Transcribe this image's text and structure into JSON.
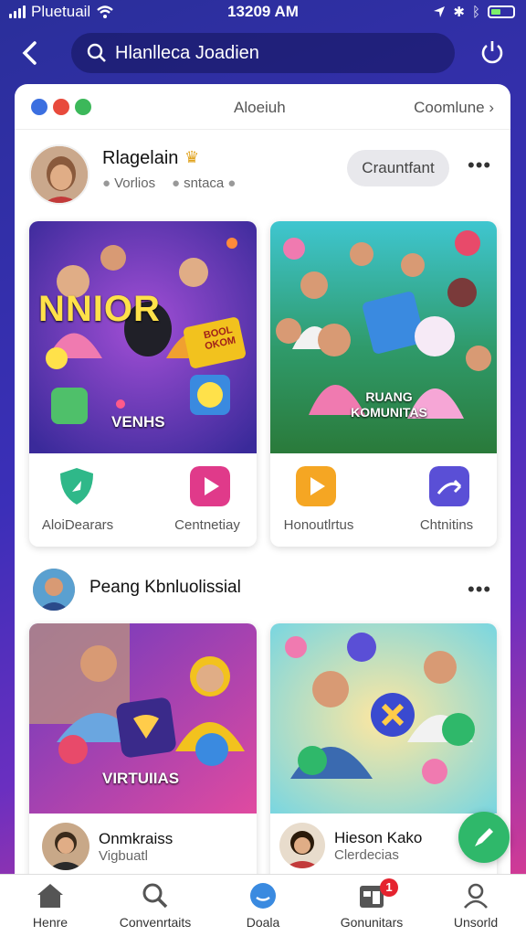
{
  "status_bar": {
    "carrier": "Pluetuail",
    "time": "13209 AM"
  },
  "search": {
    "value": "Hlanlleca Joadien"
  },
  "card_header": {
    "center_label": "Aloeiuh",
    "right_label": "Coomlune ›"
  },
  "post1": {
    "user_name": "Rlagelain",
    "meta": [
      "Vorlios",
      "sntaca"
    ],
    "follow_label": "Crauntfant",
    "tiles": [
      {
        "caption_top": "NNIOR",
        "caption_bottom": "VENHS",
        "sign": "BOOL OKOM"
      },
      {
        "caption": "RUANG KOMUNITAS"
      }
    ],
    "actions": [
      "AloiDearars",
      "Centnetiay",
      "Honoutlrtus",
      "Chtnitins"
    ]
  },
  "post2": {
    "user_name": "Peang Kbnluolissial",
    "tiles": [
      {
        "caption": "VIRTUIIAS"
      },
      {
        "caption": ""
      }
    ],
    "people": [
      {
        "name": "Onmkraiss",
        "sub": "Vigbuatl"
      },
      {
        "name": "Hieson Kako",
        "sub": "Clerdecias"
      }
    ]
  },
  "nav": {
    "items": [
      "Henre",
      "Convenrtaits",
      "Doala",
      "Gonunitars",
      "Unsorld"
    ],
    "badge_count": "1"
  },
  "colors": {
    "accent": "#3b2fb8",
    "pink": "#e83d8c",
    "green": "#2fb86a"
  }
}
